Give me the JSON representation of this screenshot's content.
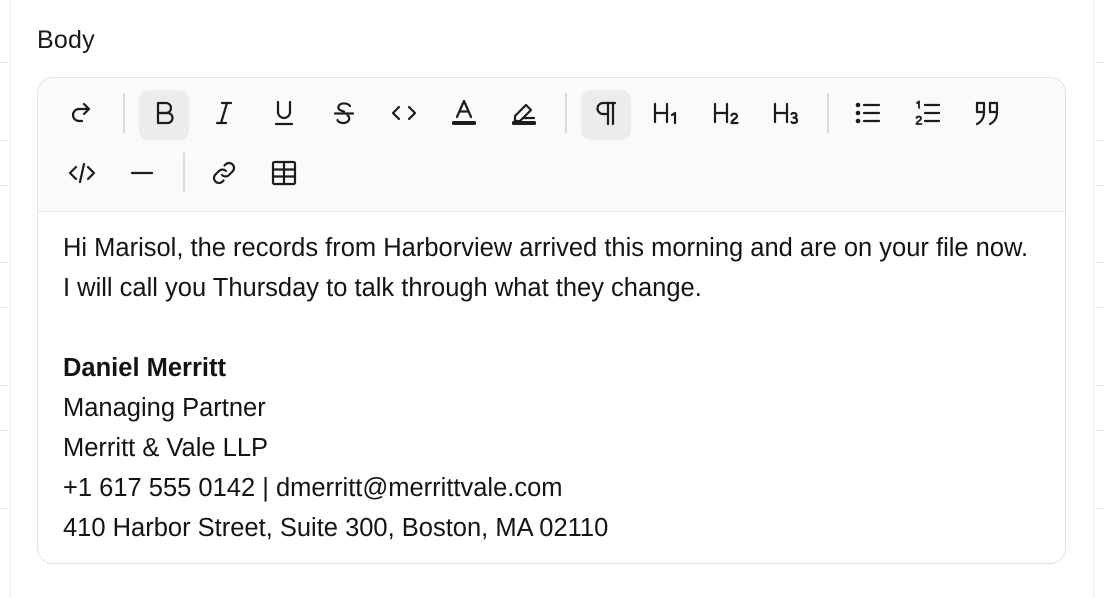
{
  "field": {
    "label": "Body"
  },
  "toolbar": {
    "buttons": [
      {
        "name": "redo-button",
        "icon": "redo-icon",
        "active": false
      },
      {
        "name": "bold-button",
        "icon": "bold-icon",
        "active": true
      },
      {
        "name": "italic-button",
        "icon": "italic-icon",
        "active": false
      },
      {
        "name": "underline-button",
        "icon": "underline-icon",
        "active": false
      },
      {
        "name": "strikethrough-button",
        "icon": "strikethrough-icon",
        "active": false
      },
      {
        "name": "inline-code-button",
        "icon": "code-icon",
        "active": false
      },
      {
        "name": "text-color-button",
        "icon": "text-color-icon",
        "active": false
      },
      {
        "name": "highlight-button",
        "icon": "highlighter-icon",
        "active": false
      },
      {
        "name": "paragraph-button",
        "icon": "pilcrow-icon",
        "active": true
      },
      {
        "name": "heading-1-button",
        "icon": "heading-1-icon",
        "active": false
      },
      {
        "name": "heading-2-button",
        "icon": "heading-2-icon",
        "active": false
      },
      {
        "name": "heading-3-button",
        "icon": "heading-3-icon",
        "active": false
      },
      {
        "name": "bullet-list-button",
        "icon": "bullet-list-icon",
        "active": false
      },
      {
        "name": "ordered-list-button",
        "icon": "numbered-list-icon",
        "active": false
      },
      {
        "name": "blockquote-button",
        "icon": "quote-icon",
        "active": false
      },
      {
        "name": "code-block-button",
        "icon": "code-block-icon",
        "active": false
      },
      {
        "name": "horizontal-rule-button",
        "icon": "horizontal-rule-icon",
        "active": false
      },
      {
        "name": "link-button",
        "icon": "link-icon",
        "active": false
      },
      {
        "name": "table-button",
        "icon": "table-icon",
        "active": false
      }
    ],
    "heading_labels": {
      "h1": {
        "letter": "H",
        "sub": "1"
      },
      "h2": {
        "letter": "H",
        "sub": "2"
      },
      "h3": {
        "letter": "H",
        "sub": "3"
      }
    }
  },
  "body": {
    "message": "Hi Marisol, the records from Harborview arrived this morning and are on your file now. I will call you Thursday to talk through what they change.",
    "signature": {
      "name": "Daniel Merritt",
      "title": "Managing Partner",
      "firm": "Merritt & Vale LLP",
      "contact": "+1 617 555 0142 | dmerritt@merrittvale.com",
      "address": "410 Harbor Street, Suite 300, Boston, MA 02110"
    }
  },
  "colors": {
    "toolbar_bg": "#fafafa",
    "active_button_bg": "#ececec",
    "border": "#e3e3e3",
    "text": "#141414"
  }
}
